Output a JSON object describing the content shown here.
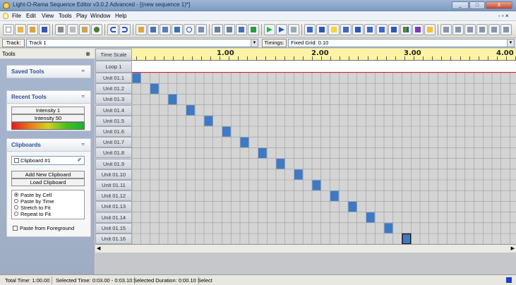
{
  "window": {
    "title": "Light-O-Rama Sequence Editor v3.0.2 Advanced - [(new sequence 1)*]",
    "controls": [
      "_",
      "□",
      "X"
    ]
  },
  "menu": {
    "items": [
      "File",
      "Edit",
      "View",
      "Tools",
      "Play",
      "Window",
      "Help"
    ]
  },
  "trackbar": {
    "track_label": "Track:",
    "track_value": "Track 1",
    "timings_label": "Timings:",
    "timings_value": "Fixed Grid: 0.10"
  },
  "tools_panel": {
    "header": "Tools",
    "pin": "⊕",
    "saved_tools": {
      "title": "Saved Tools"
    },
    "recent_tools": {
      "title": "Recent Tools",
      "items": [
        "Intensity 1",
        "Intensity 50"
      ]
    },
    "clipboards": {
      "title": "Clipboards",
      "selected": "Clipboard #1",
      "buttons": [
        "Add New Clipboard",
        "Load Clipboard"
      ],
      "paste_options": [
        "Paste by Cell",
        "Paste by Time",
        "Stretch to Fit",
        "Repeat to Fit"
      ],
      "selected_option": "Paste by Cell",
      "foreground_label": "Paste from Foreground"
    }
  },
  "grid": {
    "time_scale_label": "Time Scale",
    "loop_label": "Loop 1",
    "ruler_labels": [
      "1.00",
      "2.00",
      "3.00",
      "4.00"
    ],
    "units": [
      "Unit 01.1",
      "Unit 01.2",
      "Unit 01.3",
      "Unit 01.4",
      "Unit 01.5",
      "Unit 01.6",
      "Unit 01.7",
      "Unit 01.8",
      "Unit 01.9",
      "Unit 01.10",
      "Unit 01.11",
      "Unit 01.12",
      "Unit 01.13",
      "Unit 01.14",
      "Unit 01.15",
      "Unit 01.16"
    ],
    "on_cells": [
      0,
      1,
      2,
      3,
      4,
      5,
      6,
      7,
      8,
      9,
      10,
      11,
      12,
      13,
      14,
      15
    ],
    "selected_row": 15,
    "cell_color": "#3f79c4",
    "red_line_color": "#d42020"
  },
  "status": {
    "total_time": "Total Time: 1:00.00",
    "selected_time": "Selected Time: 0:03.00 - 0:03.10",
    "selected_duration": "Selected Duration: 0:00.10",
    "mode": "Select"
  }
}
